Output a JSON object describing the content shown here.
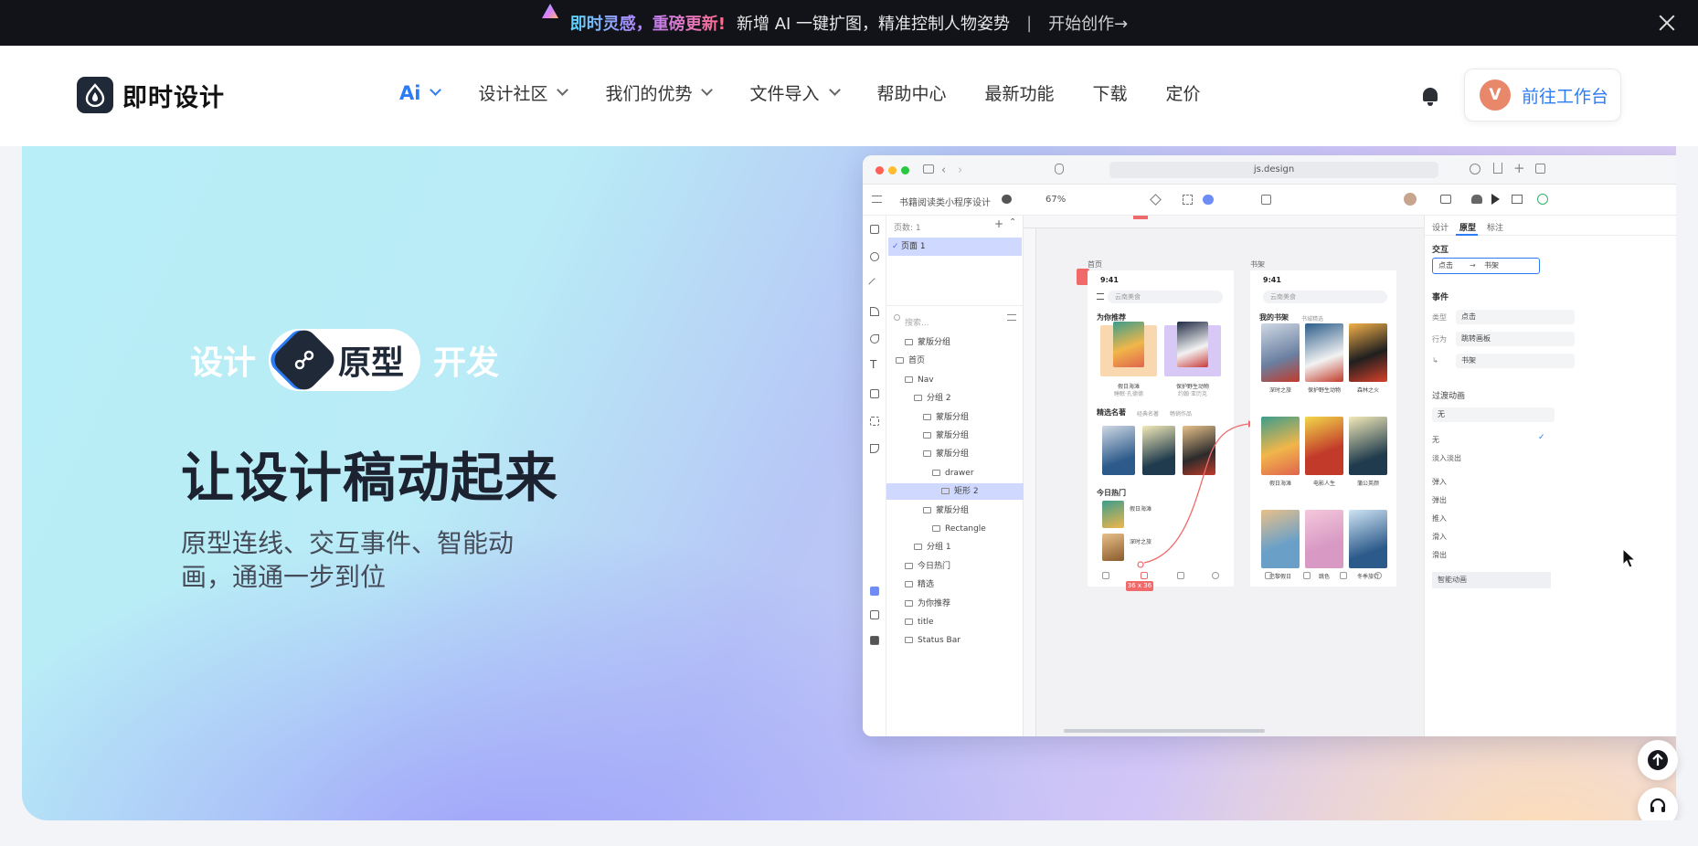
{
  "banner": {
    "strong": "即时灵感，重磅更新!",
    "text": "新增 AI 一键扩图，精准控制人物姿势",
    "separator": "|",
    "cta": "开始创作→"
  },
  "brand": {
    "name": "即时设计"
  },
  "nav": {
    "items": [
      {
        "label": "Ai"
      },
      {
        "label": "设计社区"
      },
      {
        "label": "我们的优势"
      },
      {
        "label": "文件导入"
      },
      {
        "label": "帮助中心"
      },
      {
        "label": "最新功能"
      },
      {
        "label": "下载"
      },
      {
        "label": "定价"
      }
    ],
    "avatar_letter": "V",
    "workspace_label": "前往工作台"
  },
  "hero": {
    "step1": "设计",
    "step2": "原型",
    "step3": "开发",
    "title": "让设计稿动起来",
    "subtitle": "原型连线、交互事件、智能动画，通通一步到位"
  },
  "app": {
    "url": "js.design",
    "project": "书籍阅读类小程序设计",
    "zoom": "67%",
    "pages_header": "页数: 1",
    "page": "页面 1",
    "search_placeholder": "搜索...",
    "layers": [
      {
        "label": "蒙版分组",
        "indent": 1
      },
      {
        "label": "首页",
        "indent": 0
      },
      {
        "label": "Nav",
        "indent": 1
      },
      {
        "label": "分组 2",
        "indent": 2
      },
      {
        "label": "蒙版分组",
        "indent": 3
      },
      {
        "label": "蒙版分组",
        "indent": 3
      },
      {
        "label": "蒙版分组",
        "indent": 3
      },
      {
        "label": "drawer",
        "indent": 4
      },
      {
        "label": "矩形 2",
        "indent": 5,
        "selected": true
      },
      {
        "label": "蒙版分组",
        "indent": 3
      },
      {
        "label": "Rectangle",
        "indent": 4
      },
      {
        "label": "分组 1",
        "indent": 2
      },
      {
        "label": "今日热门",
        "indent": 1
      },
      {
        "label": "精选",
        "indent": 1
      },
      {
        "label": "为你推荐",
        "indent": 1
      },
      {
        "label": "title",
        "indent": 1
      },
      {
        "label": "Status Bar",
        "indent": 1
      }
    ],
    "frame_home": "首页",
    "frame_shelf": "书架",
    "phone_time": "9:41",
    "home_search": "云南美食",
    "shelf_search": "云南美食",
    "home_sections": [
      "为你推荐",
      "精选名著",
      "今日热门"
    ],
    "home_tabs_sub": [
      "经典名著",
      "畅销作品"
    ],
    "home_books_rec": [
      "假日海滩",
      "保护野生动物"
    ],
    "home_books_rec_sub": [
      "睡眠·孔德德",
      "约翰·亚历克"
    ],
    "home_hot": [
      "假日海滩",
      "深时之旅"
    ],
    "shelf_sections": [
      "我的书架",
      "书城精选"
    ],
    "shelf_books": [
      "深时之旅",
      "保护野生动物",
      "森林之火",
      "假日海滩",
      "电影人生",
      "蒲公英颜",
      "巴黎假日",
      "跳色",
      "冬季旅行"
    ],
    "size_badge": "36 x 36",
    "props": {
      "tabs": [
        "设计",
        "原型",
        "标注"
      ],
      "interaction": "交互",
      "trigger": "点击",
      "target": "书架",
      "event": "事件",
      "type_label": "类型",
      "type_value": "点击",
      "action_label": "行为",
      "action_value": "跳转画板",
      "dest_value": "书架",
      "transition": "过渡动画",
      "transition_value": "无",
      "options": [
        "无",
        "淡入淡出",
        "弹入",
        "弹出",
        "推入",
        "滑入",
        "滑出",
        "智能动画"
      ]
    }
  },
  "colors": {
    "accent": "#2b7cf6",
    "dark": "#1f2937",
    "banner_bg": "#111318"
  }
}
